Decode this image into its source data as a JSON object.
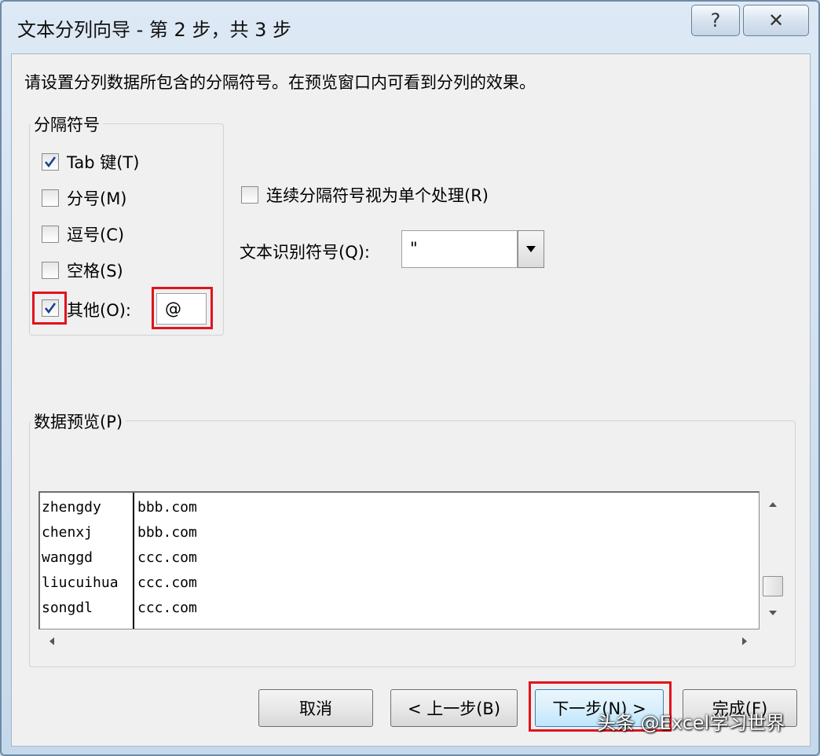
{
  "window": {
    "title": "文本分列向导 - 第 2 步，共 3 步",
    "help_label": "?",
    "close_label": "✕"
  },
  "instruction": "请设置分列数据所包含的分隔符号。在预览窗口内可看到分列的效果。",
  "delimiters": {
    "legend": "分隔符号",
    "tab": {
      "label": "Tab 键(T)",
      "checked": true
    },
    "semicolon": {
      "label": "分号(M)",
      "checked": false
    },
    "comma": {
      "label": "逗号(C)",
      "checked": false
    },
    "space": {
      "label": "空格(S)",
      "checked": false
    },
    "other": {
      "label": "其他(O):",
      "checked": true,
      "value": "@"
    }
  },
  "consecutive": {
    "label": "连续分隔符号视为单个处理(R)",
    "checked": false
  },
  "qualifier": {
    "label": "文本识别符号(Q):",
    "value": "\""
  },
  "preview": {
    "legend": "数据预览(P)",
    "rows": [
      [
        "zhengdy",
        "bbb.com"
      ],
      [
        "chenxj",
        "bbb.com"
      ],
      [
        "wanggd",
        "ccc.com"
      ],
      [
        "liucuihua",
        "ccc.com"
      ],
      [
        "songdl",
        "ccc.com"
      ]
    ]
  },
  "buttons": {
    "cancel": "取消",
    "back": "< 上一步(B)",
    "next": "下一步(N) >",
    "finish": "完成(F)"
  },
  "watermark": "头条 @Excel学习世界",
  "colors": {
    "highlight": "#e0141e",
    "check": "#1c3f94"
  },
  "icons": {
    "check": "check-icon",
    "dropdown": "triangle-down-icon",
    "scroll_up": "triangle-up-icon",
    "scroll_down": "triangle-down-icon",
    "scroll_left": "triangle-left-icon",
    "scroll_right": "triangle-right-icon"
  }
}
